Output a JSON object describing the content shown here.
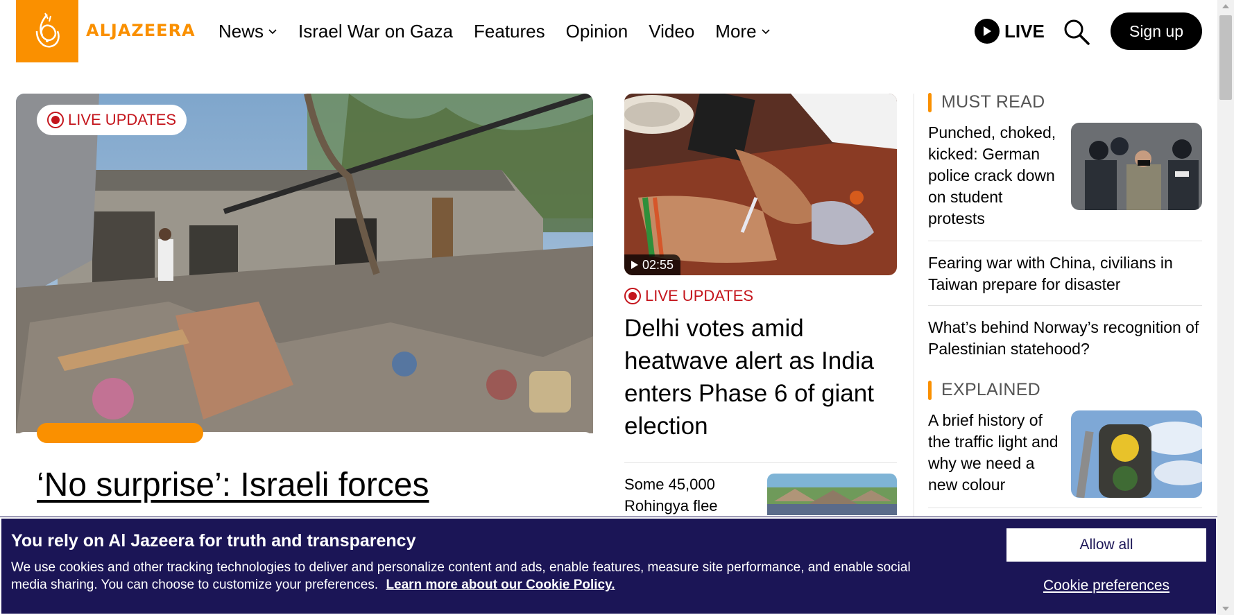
{
  "header": {
    "logo_text": "ALJAZEERA",
    "nav": [
      {
        "label": "News",
        "has_dropdown": true
      },
      {
        "label": "Israel War on Gaza",
        "has_dropdown": false
      },
      {
        "label": "Features",
        "has_dropdown": false
      },
      {
        "label": "Opinion",
        "has_dropdown": false
      },
      {
        "label": "Video",
        "has_dropdown": false
      },
      {
        "label": "More",
        "has_dropdown": true
      }
    ],
    "live_label": "LIVE",
    "signup_label": "Sign up"
  },
  "hero": {
    "badge": "LIVE UPDATES",
    "title": "‘No surprise’: Israeli forces"
  },
  "middle": {
    "video_duration": "02:55",
    "badge": "LIVE UPDATES",
    "title": "Delhi votes amid heatwave alert as India enters Phase 6 of giant election",
    "story2": "Some 45,000 Rohingya flee"
  },
  "right": {
    "must_read_label": "MUST READ",
    "must_read_items": [
      "Punched, choked, kicked: German police crack down on student protests",
      "Fearing war with China, civilians in Taiwan prepare for disaster",
      "What’s behind Norway’s recognition of Palestinian statehood?"
    ],
    "explained_label": "EXPLAINED",
    "explained_items": [
      "A brief history of the traffic light and why we need a new colour"
    ]
  },
  "cookie": {
    "title": "You rely on Al Jazeera for truth and transparency",
    "body": "We use cookies and other tracking technologies to deliver and personalize content and ads, enable features, measure site performance, and enable social media sharing. You can choose to customize your preferences.",
    "link": "Learn more about our Cookie Policy.",
    "allow_all": "Allow all",
    "preferences": "Cookie preferences"
  },
  "colors": {
    "brand_orange": "#fa9000",
    "live_red": "#c4151c",
    "cookie_bg": "#1b1556"
  }
}
